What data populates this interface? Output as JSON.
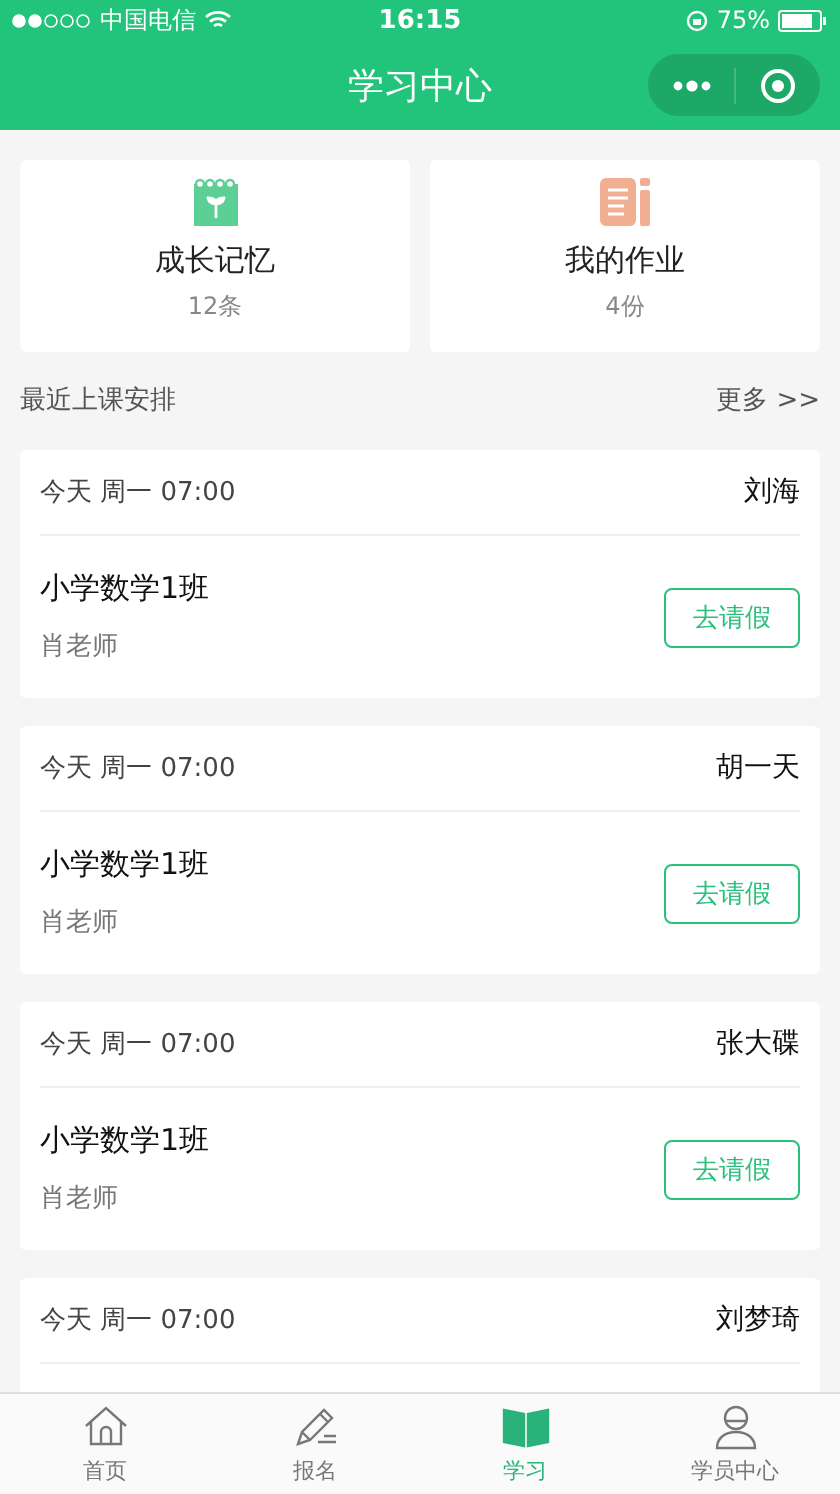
{
  "status_bar": {
    "carrier": "中国电信",
    "time": "16:15",
    "battery": "75%"
  },
  "nav": {
    "title": "学习中心"
  },
  "quick_cards": [
    {
      "kind": "memory",
      "title": "成长记忆",
      "count": "12条"
    },
    {
      "kind": "homework",
      "title": "我的作业",
      "count": "4份"
    }
  ],
  "section": {
    "title": "最近上课安排",
    "more": "更多 >>"
  },
  "lessons": [
    {
      "time": "今天 周一 07:00",
      "student": "刘海",
      "course": "小学数学1班",
      "teacher": "肖老师",
      "action": "去请假"
    },
    {
      "time": "今天 周一 07:00",
      "student": "胡一天",
      "course": "小学数学1班",
      "teacher": "肖老师",
      "action": "去请假"
    },
    {
      "time": "今天 周一 07:00",
      "student": "张大碟",
      "course": "小学数学1班",
      "teacher": "肖老师",
      "action": "去请假"
    },
    {
      "time": "今天 周一 07:00",
      "student": "刘梦琦"
    }
  ],
  "tab_bar": [
    {
      "kind": "home",
      "label": "首页",
      "selected": false
    },
    {
      "kind": "signup",
      "label": "报名",
      "selected": false
    },
    {
      "kind": "study",
      "label": "学习",
      "selected": true
    },
    {
      "kind": "member",
      "label": "学员中心",
      "selected": false
    }
  ]
}
